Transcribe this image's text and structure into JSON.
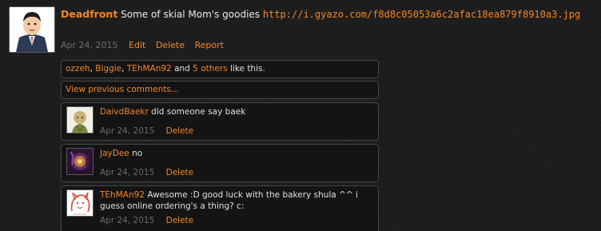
{
  "post": {
    "author": "Deadfront",
    "text": "Some of skial Mom's goodies",
    "url": "http://i.gyazo.com/f8d8c05053a6c2afac18ea879f8910a3.jpg",
    "date": "Apr 24, 2015",
    "actions": {
      "edit": "Edit",
      "delete": "Delete",
      "report": "Report"
    }
  },
  "likes": {
    "user1": "ozzeh",
    "sep1": ", ",
    "user2": "Biggie",
    "sep2": ", ",
    "user3": "TEhMAn92",
    "and": " and ",
    "others": "5 others",
    "suffix": " like this."
  },
  "view_previous": "View previous comments...",
  "comments": [
    {
      "author": "DaivdBaekr",
      "text": "did someone say baek",
      "date": "Apr 24, 2015",
      "delete": "Delete"
    },
    {
      "author": "JayDee",
      "text": "no",
      "date": "Apr 24, 2015",
      "delete": "Delete"
    },
    {
      "author": "TEhMAn92",
      "text": "Awesome :D good luck with the bakery shula ^^ i guess online ordering's a thing? c:",
      "date": "Apr 24, 2015",
      "delete": "Delete"
    }
  ]
}
